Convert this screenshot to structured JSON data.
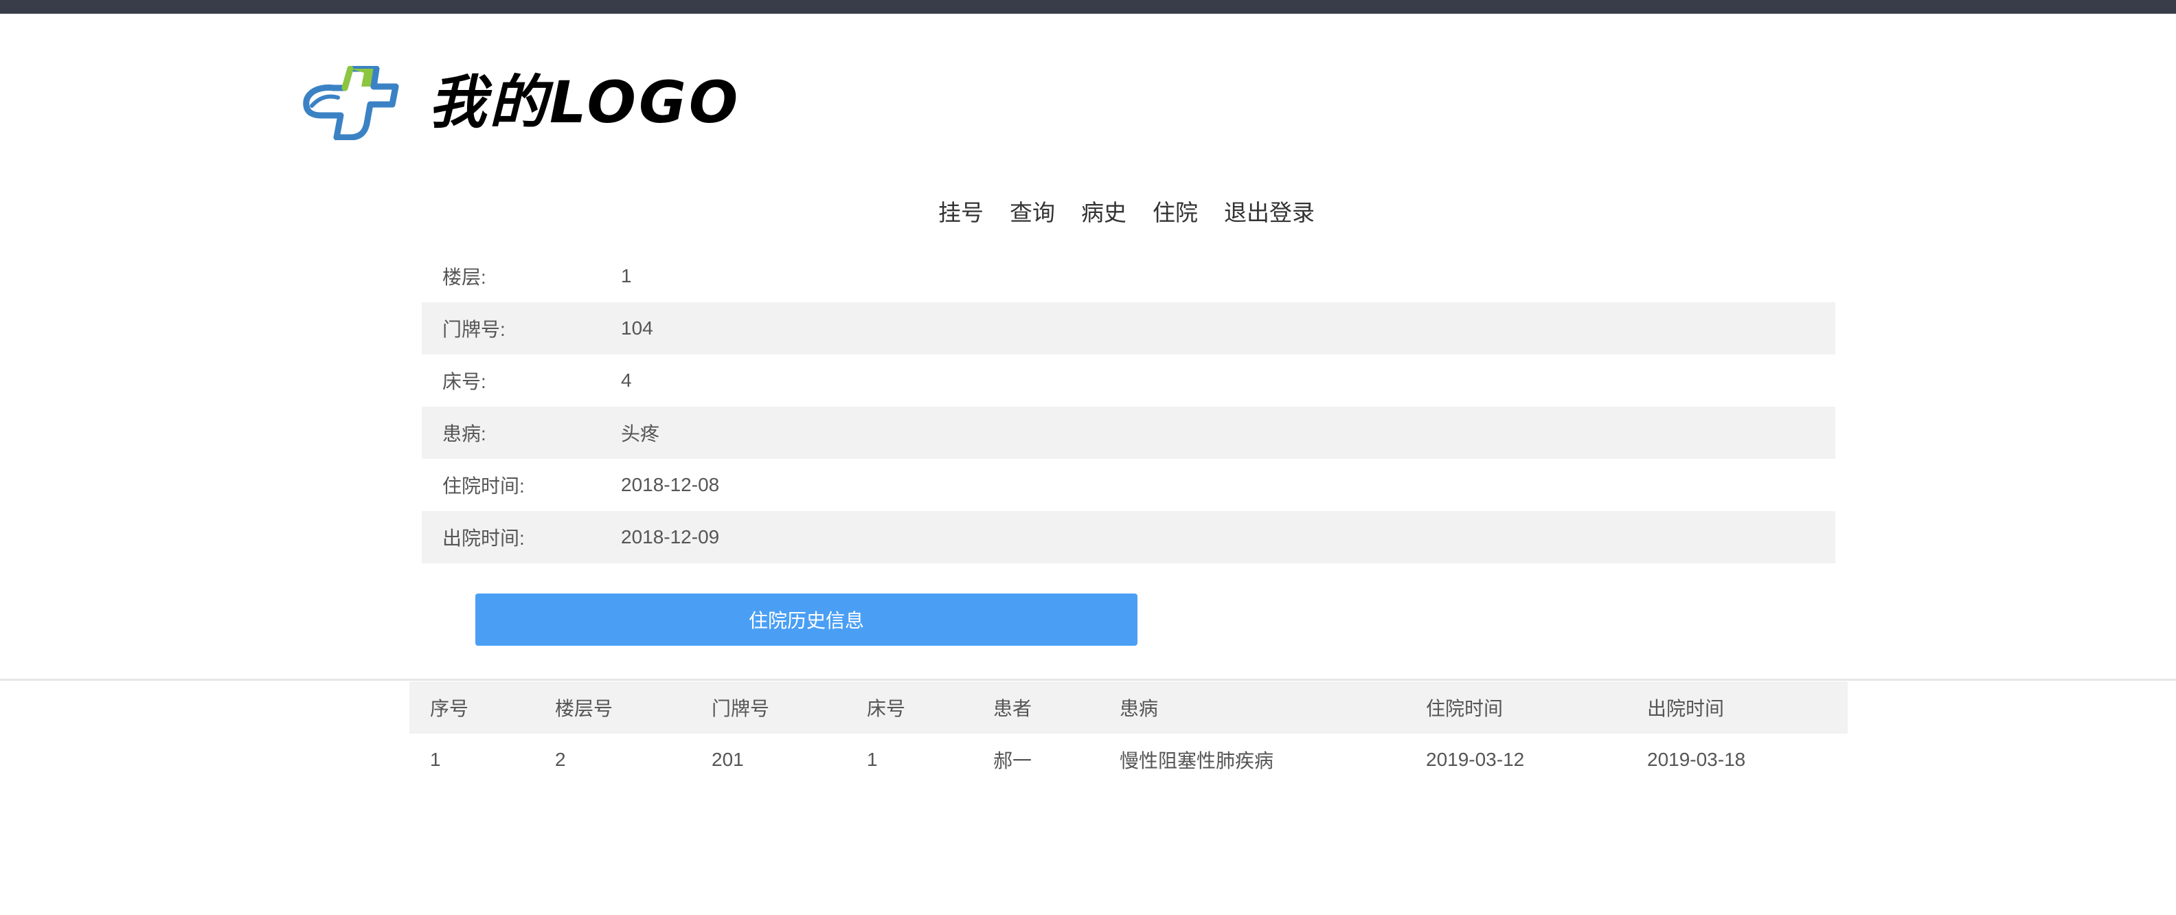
{
  "header": {
    "logo_text": "我的LOGO",
    "logo_icon": "medical-cross-leaf-icon",
    "colors": {
      "cross_blue": "#3b82c4",
      "cross_green": "#8cc63f",
      "topbar": "#393d49"
    }
  },
  "nav": {
    "items": [
      {
        "label": "挂号"
      },
      {
        "label": "查询"
      },
      {
        "label": "病史"
      },
      {
        "label": "住院"
      },
      {
        "label": "退出登录"
      }
    ]
  },
  "info": {
    "rows": [
      {
        "label": "楼层:",
        "value": "1"
      },
      {
        "label": "门牌号:",
        "value": "104"
      },
      {
        "label": "床号:",
        "value": "4"
      },
      {
        "label": "患病:",
        "value": "头疼"
      },
      {
        "label": "住院时间:",
        "value": "2018-12-08"
      },
      {
        "label": "出院时间:",
        "value": "2018-12-09"
      }
    ]
  },
  "history_button": {
    "label": "住院历史信息",
    "color": "#4a9ff5"
  },
  "history_table": {
    "headers": [
      "序号",
      "楼层号",
      "门牌号",
      "床号",
      "患者",
      "患病",
      "住院时间",
      "出院时间"
    ],
    "rows": [
      [
        "1",
        "2",
        "201",
        "1",
        "郝一",
        "慢性阻塞性肺疾病",
        "2019-03-12",
        "2019-03-18"
      ]
    ]
  }
}
